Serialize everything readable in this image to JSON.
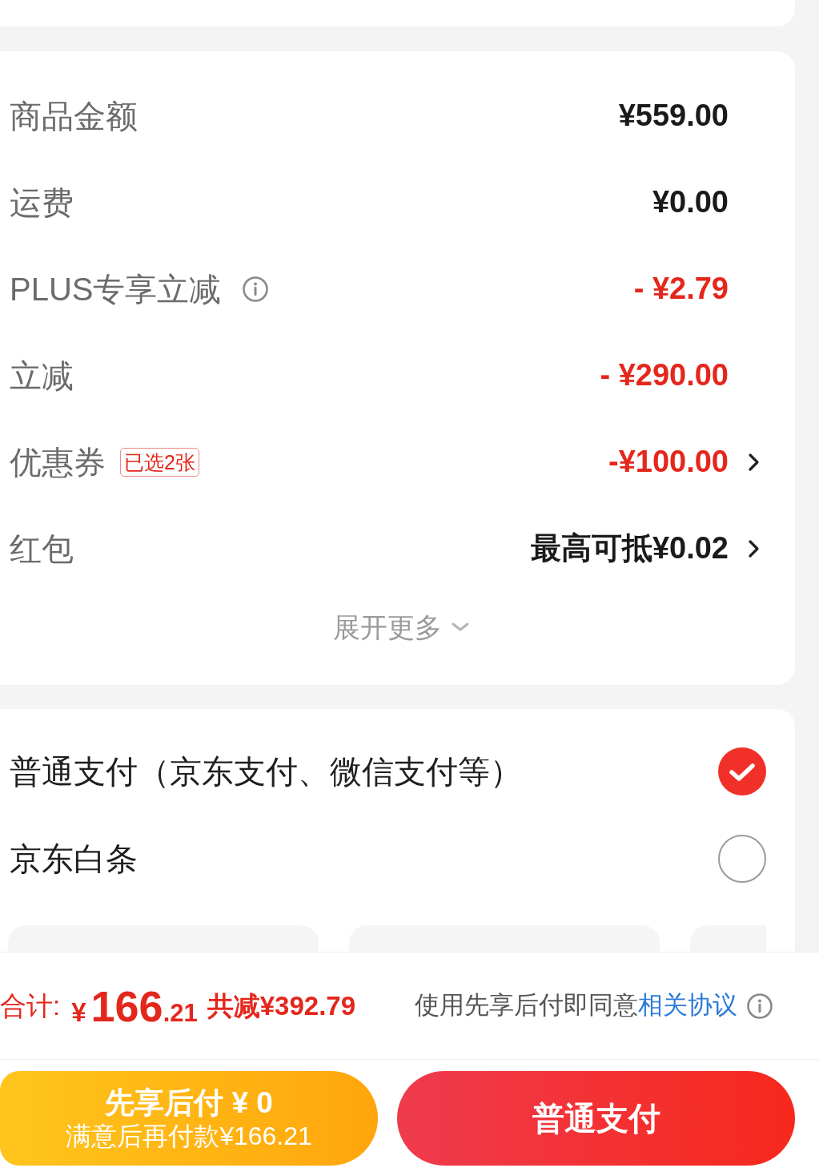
{
  "price_summary": {
    "rows": [
      {
        "label": "商品金额",
        "value": "¥559.00",
        "discount": false,
        "info": false,
        "arrow": false
      },
      {
        "label": "运费",
        "value": "¥0.00",
        "discount": false,
        "info": false,
        "arrow": false
      },
      {
        "label": "PLUS专享立减",
        "value": "- ¥2.79",
        "discount": true,
        "info": true,
        "arrow": false
      },
      {
        "label": "立减",
        "value": "- ¥290.00",
        "discount": true,
        "info": false,
        "arrow": false
      },
      {
        "label": "优惠券",
        "badge": "已选2张",
        "value": "-¥100.00",
        "discount": true,
        "info": false,
        "arrow": true
      },
      {
        "label": "红包",
        "value": "最高可抵¥0.02",
        "discount": false,
        "info": false,
        "arrow": true
      }
    ],
    "expand": {
      "label": "展开更多"
    }
  },
  "payment": {
    "options": [
      {
        "label": "普通支付（京东支付、微信支付等）",
        "selected": true
      },
      {
        "label": "京东白条",
        "selected": false
      }
    ]
  },
  "checkout": {
    "total_label": "合计:",
    "total": {
      "symbol": "¥",
      "integer": "166",
      "fraction": ".21"
    },
    "saved": "共减¥392.79",
    "agreement": {
      "text": "使用先享后付即同意",
      "link": "相关协议"
    },
    "buttons": [
      {
        "kind": "pay_later",
        "title": "先享后付 ¥ 0",
        "subtitle": "满意后再付款¥166.21"
      },
      {
        "kind": "pay_now",
        "title": "普通支付"
      }
    ]
  }
}
